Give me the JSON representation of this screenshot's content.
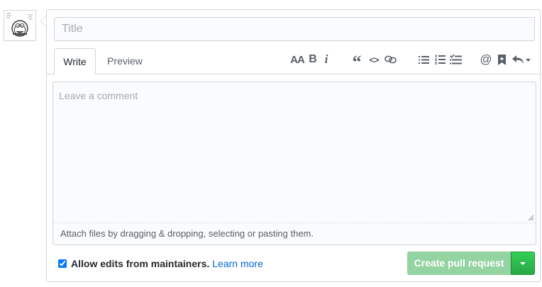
{
  "title_input": {
    "placeholder": "Title",
    "value": ""
  },
  "tabs": [
    {
      "label": "Write",
      "active": true
    },
    {
      "label": "Preview",
      "active": false
    }
  ],
  "toolbar": {
    "header_label": "AA",
    "bold_label": "B",
    "italic_label": "i",
    "quote_label": "“",
    "code_label": "<>",
    "mention_label": "@",
    "icons": [
      "text-size-icon",
      "bold-icon",
      "italic-icon",
      "quote-icon",
      "code-icon",
      "link-icon",
      "unordered-list-icon",
      "ordered-list-icon",
      "task-list-icon",
      "mention-icon",
      "bookmark-icon",
      "reply-icon"
    ]
  },
  "comment": {
    "placeholder": "Leave a comment",
    "value": "",
    "attach_text": "Attach files by dragging & dropping, selecting or pasting them."
  },
  "maintainers": {
    "checked": true,
    "label": "Allow edits from maintainers.",
    "learn_more": "Learn more"
  },
  "submit": {
    "label": "Create pull request",
    "disabled": true
  },
  "colors": {
    "border": "#d1d5da",
    "link": "#0366d6",
    "button_green": "#28a745",
    "button_disabled": "#94d3a2",
    "icon": "#586069"
  }
}
